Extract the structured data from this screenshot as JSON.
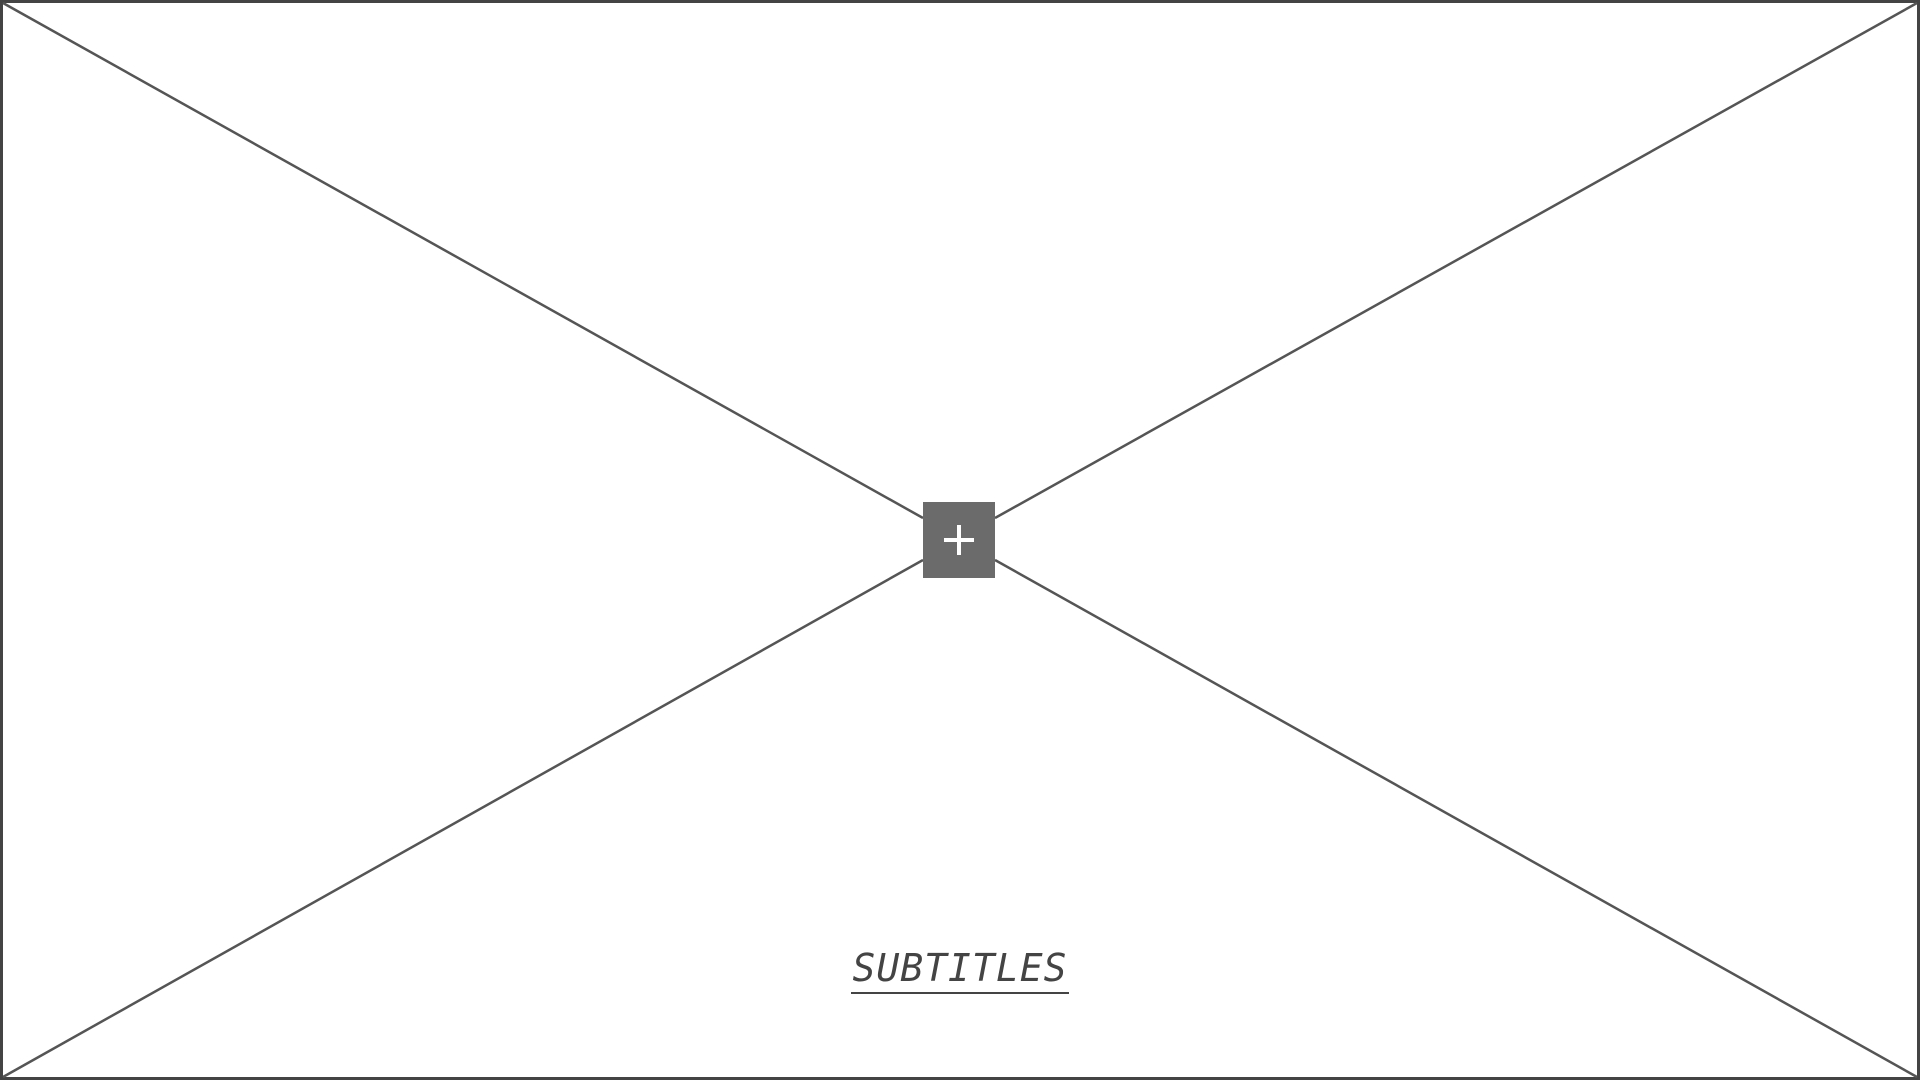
{
  "placeholder": {
    "add_button": {
      "icon": "plus-icon",
      "label": "+"
    },
    "subtitles": {
      "label": "SUBTITLES"
    }
  },
  "colors": {
    "border": "#444444",
    "cross_lines": "#555555",
    "button_bg": "#6b6b6b",
    "button_icon": "#ffffff",
    "background": "#ffffff",
    "text": "#444444"
  }
}
